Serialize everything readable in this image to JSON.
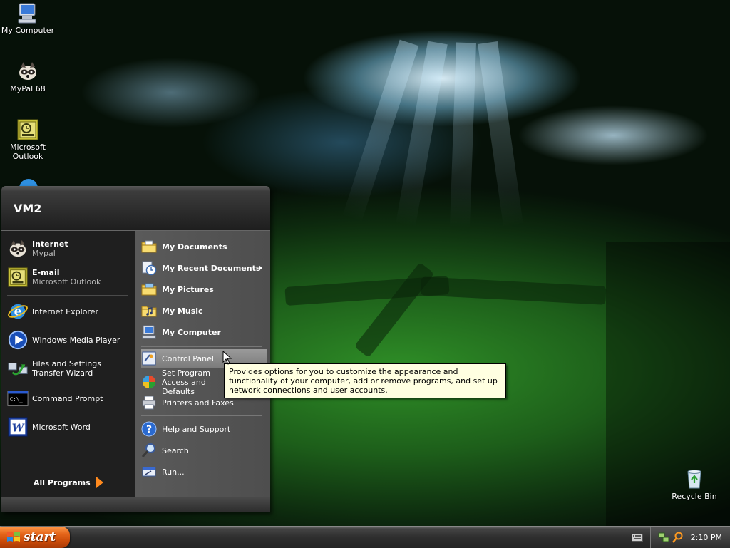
{
  "desktop": {
    "icons": [
      {
        "label": "My Computer"
      },
      {
        "label": "MyPal 68"
      },
      {
        "label": "Microsoft Outlook"
      },
      {
        "label": "Recycle Bin"
      }
    ]
  },
  "start_menu": {
    "user_name": "VM2",
    "pinned": [
      {
        "title": "Internet",
        "subtitle": "Mypal"
      },
      {
        "title": "E-mail",
        "subtitle": "Microsoft Outlook"
      }
    ],
    "recent": [
      {
        "label": "Internet Explorer"
      },
      {
        "label": "Windows Media Player"
      },
      {
        "label": "Files and Settings Transfer Wizard"
      },
      {
        "label": "Command Prompt"
      },
      {
        "label": "Microsoft Word"
      }
    ],
    "all_programs": "All Programs",
    "places": [
      {
        "label": "My Documents"
      },
      {
        "label": "My Recent Documents"
      },
      {
        "label": "My Pictures"
      },
      {
        "label": "My Music"
      },
      {
        "label": "My Computer"
      }
    ],
    "settings": [
      {
        "label": "Control Panel"
      },
      {
        "label": "Set Program Access and Defaults"
      },
      {
        "label": "Printers and Faxes"
      }
    ],
    "help": [
      {
        "label": "Help and Support"
      },
      {
        "label": "Search"
      },
      {
        "label": "Run..."
      }
    ]
  },
  "tooltip": {
    "text": "Provides options for you to customize the appearance and functionality of your computer, add or remove programs, and set up network connections and user accounts."
  },
  "taskbar": {
    "start_label": "start",
    "clock": "2:10 PM"
  },
  "colors": {
    "start_button": "#e4641a",
    "tooltip_bg": "#ffffe1",
    "menu_left": "#1f1f1f",
    "menu_right": "#555555"
  }
}
